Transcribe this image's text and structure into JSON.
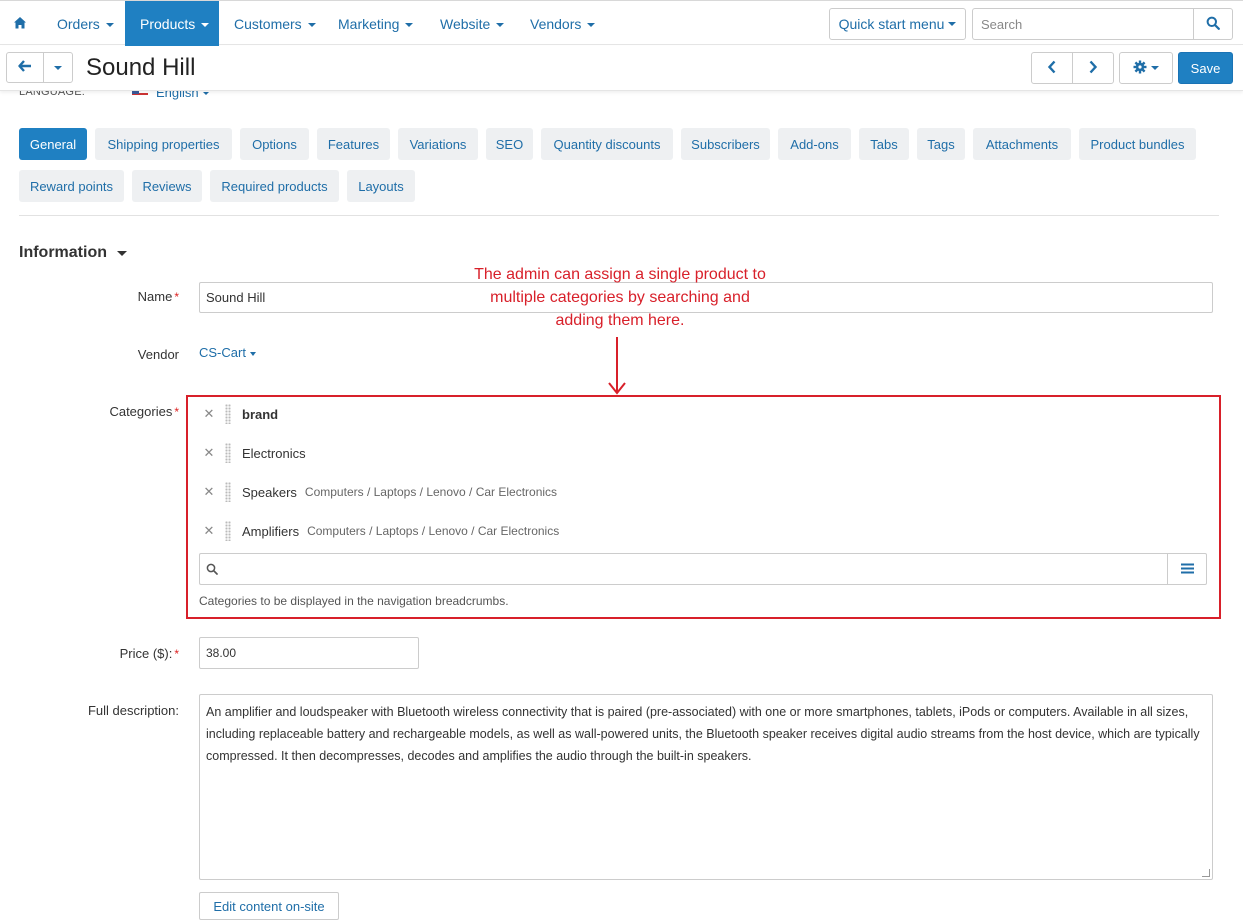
{
  "topnav": {
    "items": [
      {
        "label": "Orders"
      },
      {
        "label": "Products"
      },
      {
        "label": "Customers"
      },
      {
        "label": "Marketing"
      },
      {
        "label": "Website"
      },
      {
        "label": "Vendors"
      }
    ],
    "active_item": "Products",
    "quick_start_label": "Quick start menu",
    "search_placeholder": "Search"
  },
  "header": {
    "title": "Sound Hill",
    "save_label": "Save"
  },
  "language": {
    "label": "LANGUAGE:",
    "value": "English"
  },
  "tabs": [
    {
      "label": "General",
      "active": true
    },
    {
      "label": "Shipping properties"
    },
    {
      "label": "Options"
    },
    {
      "label": "Features"
    },
    {
      "label": "Variations"
    },
    {
      "label": "SEO"
    },
    {
      "label": "Quantity discounts"
    },
    {
      "label": "Subscribers"
    },
    {
      "label": "Add-ons"
    },
    {
      "label": "Tabs"
    },
    {
      "label": "Tags"
    },
    {
      "label": "Attachments"
    },
    {
      "label": "Product bundles"
    },
    {
      "label": "Reward points"
    },
    {
      "label": "Reviews"
    },
    {
      "label": "Required products"
    },
    {
      "label": "Layouts"
    }
  ],
  "section": {
    "title": "Information"
  },
  "form": {
    "name_label": "Name",
    "name_value": "Sound Hill",
    "vendor_label": "Vendor",
    "vendor_value": "CS-Cart",
    "categories_label": "Categories",
    "categories": [
      {
        "name": "brand",
        "path": "",
        "bold": true
      },
      {
        "name": "Electronics",
        "path": ""
      },
      {
        "name": "Speakers",
        "path": "Computers / Laptops / Lenovo / Car Electronics"
      },
      {
        "name": "Amplifiers",
        "path": "Computers / Laptops / Lenovo / Car Electronics"
      }
    ],
    "categories_help": "Categories to be displayed in the navigation breadcrumbs.",
    "price_label": "Price ($):",
    "price_value": "38.00",
    "description_label": "Full description:",
    "description_value": "An amplifier and loudspeaker with Bluetooth wireless connectivity that is paired (pre-associated) with one or more smartphones, tablets, iPods or computers. Available in all sizes, including replaceable battery and rechargeable models, as well as wall-powered units, the Bluetooth speaker receives digital audio streams from the host device, which are typically compressed. It then decompresses, decodes and amplifies the audio through the built-in speakers.",
    "edit_onsite_label": "Edit content on-site"
  },
  "annotation": {
    "text": "The admin can assign a single product to multiple categories by searching and adding them here."
  },
  "colors": {
    "accent": "#1f80c2",
    "link": "#1f6ea8",
    "annotation_red": "#d8202a"
  }
}
